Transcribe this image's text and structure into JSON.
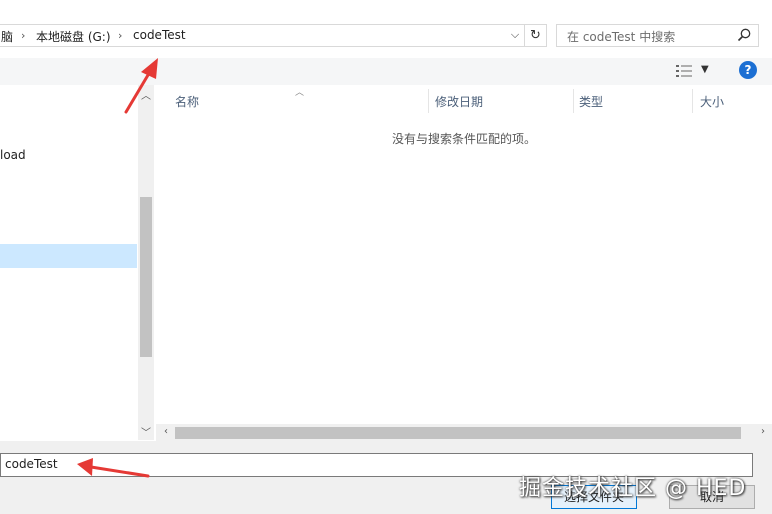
{
  "address_bar": {
    "crumbs": [
      "脑",
      "本地磁盘 (G:)",
      "codeTest"
    ],
    "separator": "›"
  },
  "search": {
    "placeholder": "在 codeTest 中搜索"
  },
  "toolbar": {
    "help_label": "?"
  },
  "nav": {
    "items": [
      {
        "label": "load"
      }
    ]
  },
  "file_list": {
    "columns": [
      {
        "label": "名称"
      },
      {
        "label": "修改日期"
      },
      {
        "label": "类型"
      },
      {
        "label": "大小"
      }
    ],
    "empty_message": "没有与搜索条件匹配的项。"
  },
  "bottom": {
    "folder_value": "codeTest",
    "select_folder_label": "选择文件夹",
    "cancel_label": "取消"
  },
  "watermark": "掘金技术社区 @ HED",
  "colors": {
    "selection": "#cce8ff",
    "primary_border": "#0078d7",
    "annotation_arrow": "#e53935",
    "help_icon": "#1c6fd3"
  }
}
